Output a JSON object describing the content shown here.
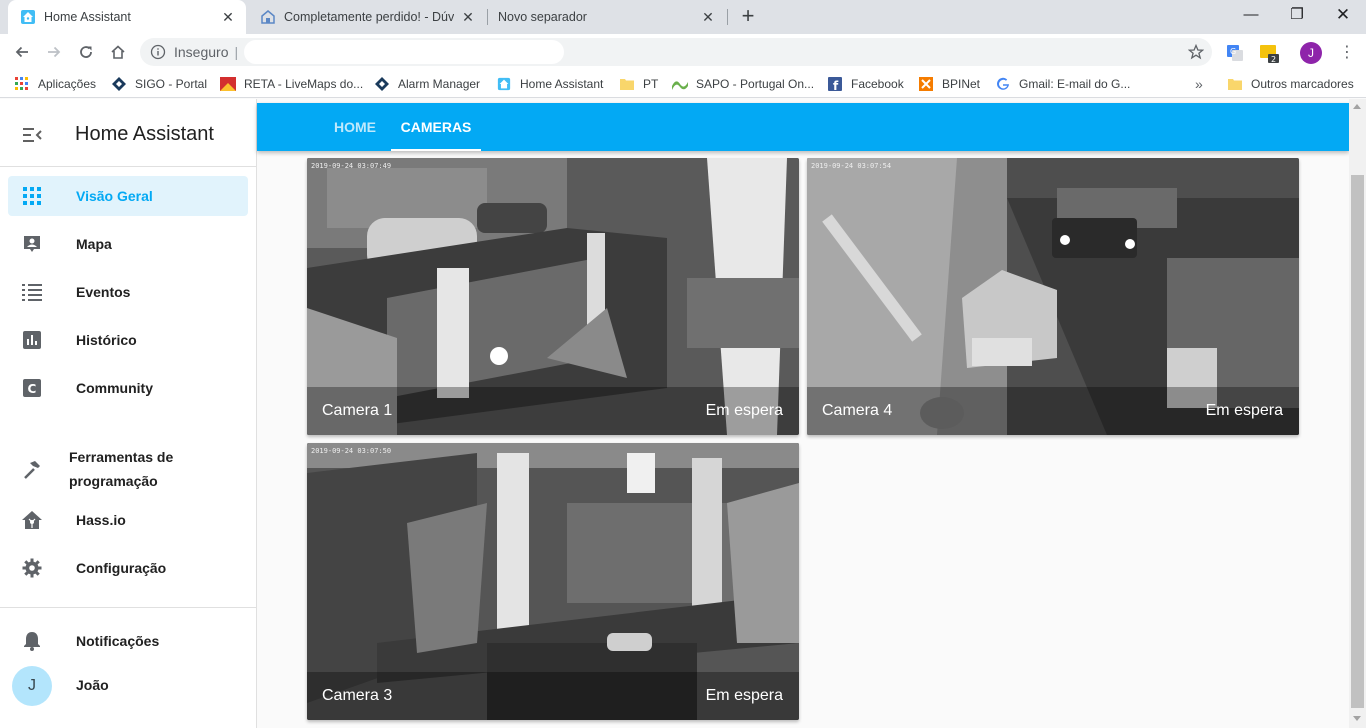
{
  "browser": {
    "tabs": [
      {
        "title": "Home Assistant",
        "active": true
      },
      {
        "title": "Completamente perdido! - Dúvid",
        "active": false
      },
      {
        "title": "Novo separador",
        "active": false
      }
    ],
    "address": {
      "security_label": "Inseguro",
      "separator": "|"
    },
    "profile_initial": "J",
    "extension_badge": "2"
  },
  "bookmarks": [
    {
      "label": "Aplicações",
      "icon": "apps-grid-icon"
    },
    {
      "label": "SIGO - Portal",
      "icon": "diamond-icon"
    },
    {
      "label": "RETA - LiveMaps do...",
      "icon": "sgr-logo-icon"
    },
    {
      "label": "Alarm Manager",
      "icon": "diamond-icon"
    },
    {
      "label": "Home Assistant",
      "icon": "home-assistant-icon"
    },
    {
      "label": "PT",
      "icon": "folder-icon"
    },
    {
      "label": "SAPO - Portugal On...",
      "icon": "sapo-icon"
    },
    {
      "label": "Facebook",
      "icon": "facebook-icon"
    },
    {
      "label": "BPINet",
      "icon": "bpi-icon"
    },
    {
      "label": "Gmail: E-mail do G...",
      "icon": "google-icon"
    },
    {
      "label": "Outros marcadores",
      "icon": "folder-icon"
    }
  ],
  "sidebar": {
    "title": "Home Assistant",
    "items": [
      {
        "label": "Visão Geral",
        "icon": "apps-icon",
        "selected": true
      },
      {
        "label": "Mapa",
        "icon": "account-box-icon"
      },
      {
        "label": "Eventos",
        "icon": "list-icon"
      },
      {
        "label": "Histórico",
        "icon": "chart-box-icon"
      },
      {
        "label": "Community",
        "icon": "community-icon"
      },
      {
        "label_line1": "Ferramentas de",
        "label_line2": "programação",
        "icon": "hammer-icon"
      },
      {
        "label": "Hass.io",
        "icon": "hassio-icon"
      },
      {
        "label": "Configuração",
        "icon": "settings-icon"
      }
    ],
    "notifications": "Notificações",
    "user": {
      "initial": "J",
      "name": "João"
    }
  },
  "header": {
    "tabs": [
      {
        "label": "HOME",
        "active": false
      },
      {
        "label": "CAMERAS",
        "active": true
      }
    ]
  },
  "cameras": [
    {
      "name": "Camera 1",
      "state": "Em espera",
      "timestamp": "2019-09-24 03:07:49"
    },
    {
      "name": "Camera 4",
      "state": "Em espera",
      "timestamp": "2019-09-24 03:07:54"
    },
    {
      "name": "Camera 3",
      "state": "Em espera",
      "timestamp": "2019-09-24 03:07:50"
    }
  ],
  "colors": {
    "accent": "#03a9f4",
    "selected_bg": "#e1f3fc",
    "tabstrip": "#dee1e6"
  }
}
